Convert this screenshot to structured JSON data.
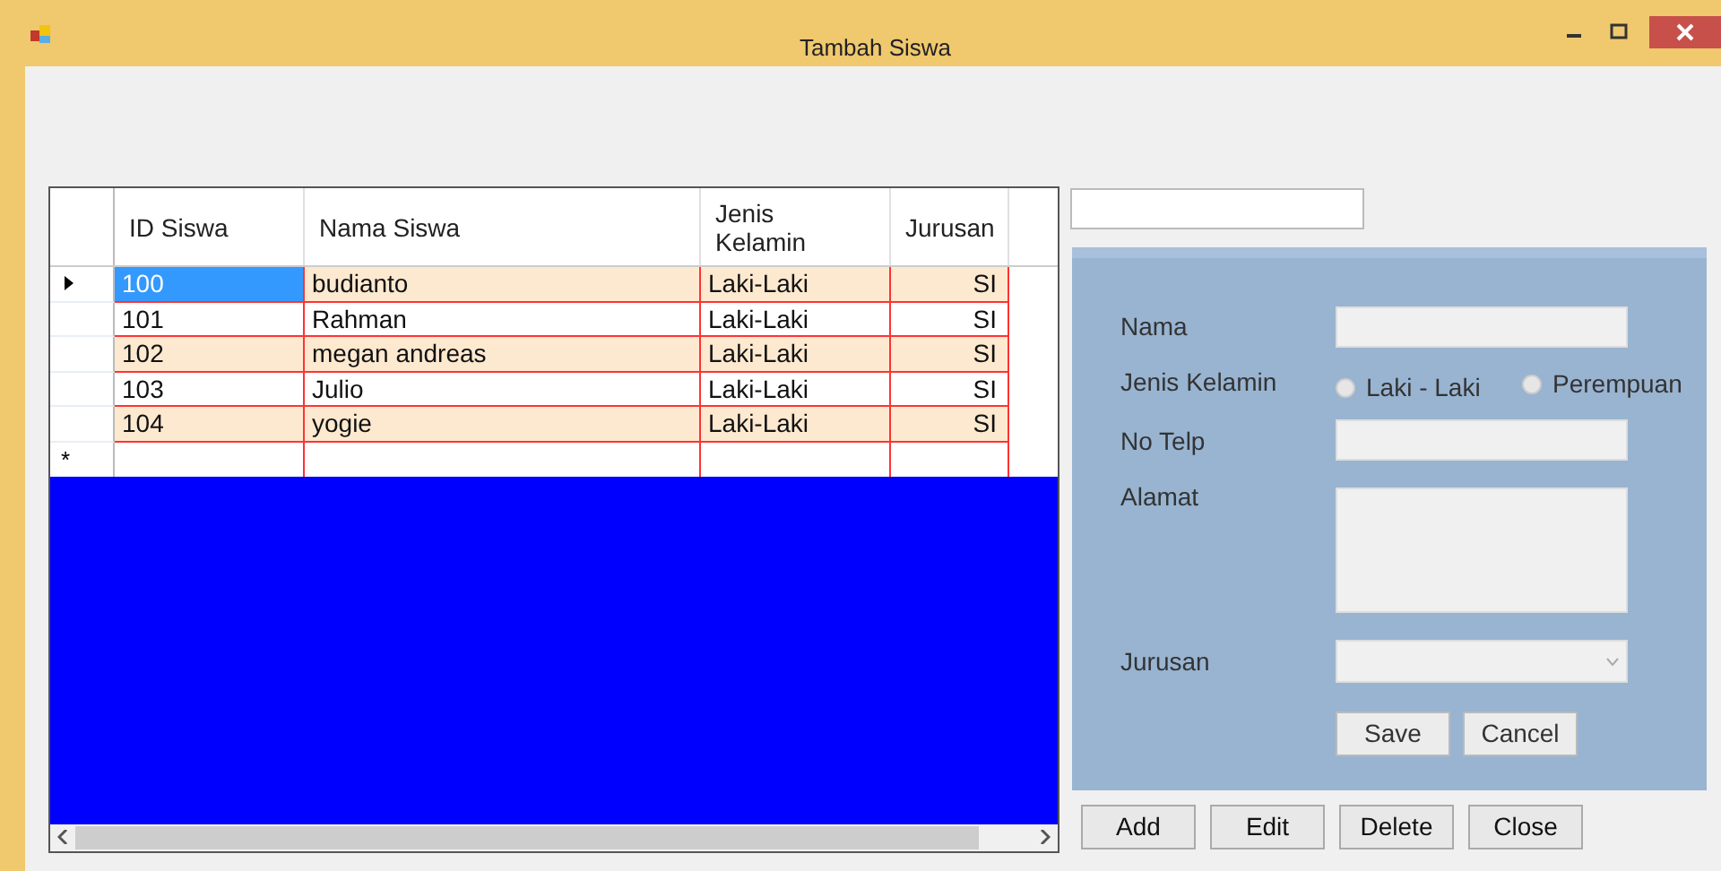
{
  "window": {
    "title": "Tambah Siswa"
  },
  "grid": {
    "columns": [
      "ID Siswa",
      "Nama Siswa",
      "Jenis Kelamin",
      "Jurusan"
    ],
    "rows": [
      {
        "selected": true,
        "cells": [
          "100",
          "budianto",
          "Laki-Laki",
          "SI"
        ]
      },
      {
        "selected": false,
        "cells": [
          "101",
          "Rahman",
          "Laki-Laki",
          "SI"
        ]
      },
      {
        "selected": false,
        "cells": [
          "102",
          "megan andreas",
          "Laki-Laki",
          "SI"
        ]
      },
      {
        "selected": false,
        "cells": [
          "103",
          "Julio",
          "Laki-Laki",
          "SI"
        ]
      },
      {
        "selected": false,
        "cells": [
          "104",
          "yogie",
          "Laki-Laki",
          "SI"
        ]
      }
    ],
    "new_row_marker": "*"
  },
  "form": {
    "nama_label": "Nama",
    "gender_label": "Jenis Kelamin",
    "gender_options": [
      {
        "label": "Laki - Laki",
        "checked": false
      },
      {
        "label": "Perempuan",
        "checked": false
      }
    ],
    "telp_label": "No Telp",
    "alamat_label": "Alamat",
    "jurusan_label": "Jurusan",
    "buttons": [
      "Save",
      "Cancel"
    ]
  },
  "buttons": [
    "Add",
    "Edit",
    "Delete",
    "Close"
  ]
}
